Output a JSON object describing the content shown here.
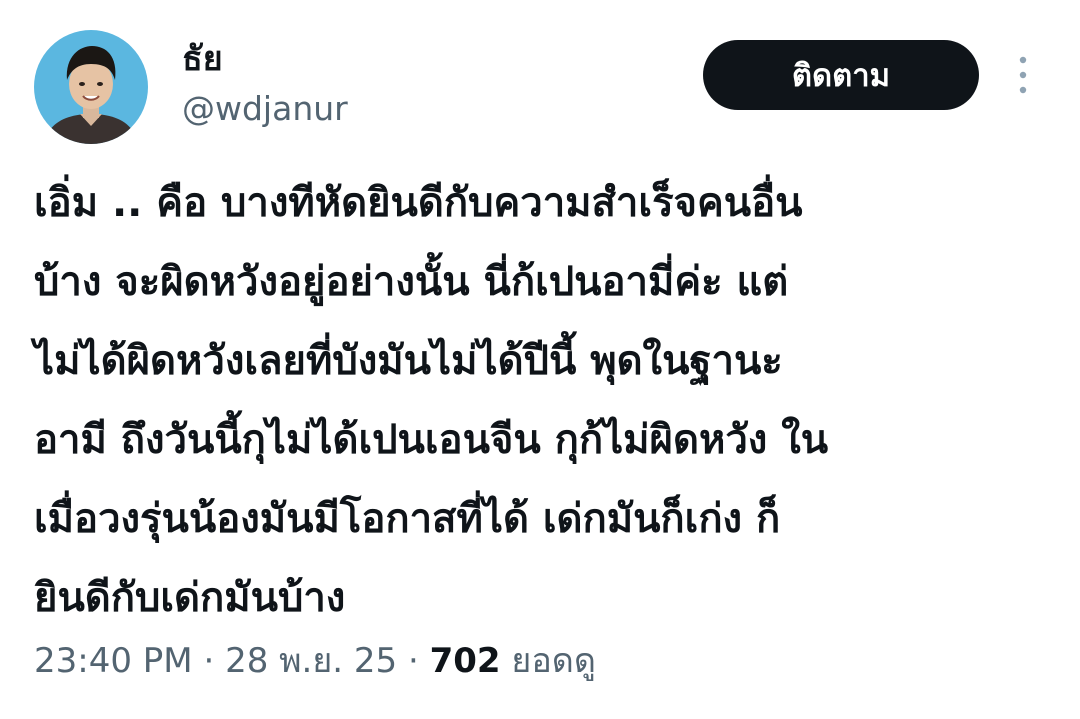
{
  "user": {
    "display_name": "ธัย",
    "handle": "@wdjanur"
  },
  "actions": {
    "follow_label": "ติดตาม",
    "more_icon": "vertical-ellipsis-icon"
  },
  "tweet": {
    "lines": [
      "เอิ่ม .. คือ บางทีหัดยินดีกับความสำเร็จคนอื่น",
      "บ้าง จะผิดหวังอยู่อย่างนั้น นี่ก้เปนอามี่ค่ะ แต่",
      "ไม่ได้ผิดหวังเลยที่บังมันไม่ได้ปีนี้ พุดในฐานะ",
      "อามี ถึงวันนี้กุไม่ได้เปนเอนจีน กุก้ไม่ผิดหวัง ใน",
      "เมื่อวงรุ่นน้องมันมีโอกาสที่ได้ เด่กมันก็เก่ง ก็",
      "ยินดีกับเด่กมันบ้าง"
    ]
  },
  "meta": {
    "time": "23:40 PM",
    "separator": "·",
    "date": "28 พ.ย. 25",
    "views_count": "702",
    "views_label": "ยอดดู"
  },
  "colors": {
    "text_primary": "#0f1419",
    "text_secondary": "#536471",
    "button_bg": "#0f1419",
    "button_text": "#ffffff",
    "avatar_bg": "#5bb7e0"
  }
}
